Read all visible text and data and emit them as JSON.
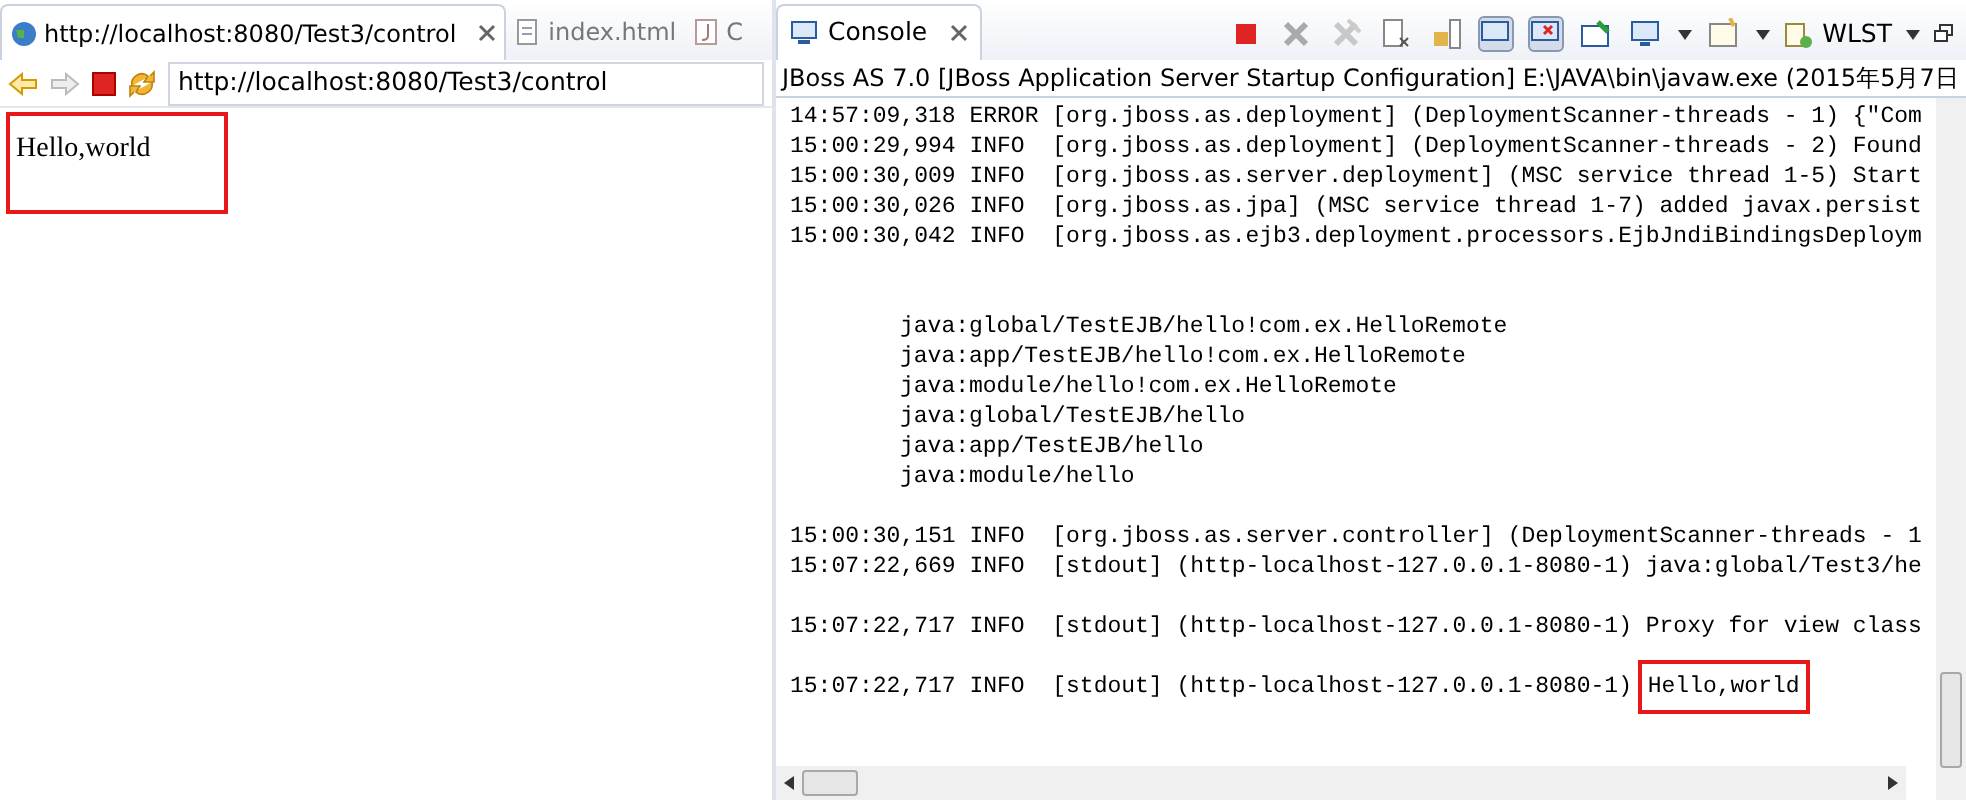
{
  "browser": {
    "tabs": [
      {
        "label": "http://localhost:8080/Test3/control",
        "kind": "web",
        "selected": true
      },
      {
        "label": "index.html",
        "kind": "file",
        "selected": false
      },
      {
        "label": "C",
        "kind": "java",
        "selected": false
      }
    ],
    "address": "http://localhost:8080/Test3/control",
    "page_text": "Hello,world"
  },
  "console": {
    "tab": "Console",
    "toolbar_label": "WLST",
    "description": "JBoss AS 7.0 [JBoss Application Server Startup Configuration] E:\\JAVA\\bin\\javaw.exe (2015年5月7日",
    "lines": [
      {
        "kind": "log",
        "text": "14:57:09,318 ERROR [org.jboss.as.deployment] (DeploymentScanner-threads - 1) {\"Com"
      },
      {
        "kind": "log",
        "text": "15:00:29,994 INFO  [org.jboss.as.deployment] (DeploymentScanner-threads - 2) Found"
      },
      {
        "kind": "log",
        "text": "15:00:30,009 INFO  [org.jboss.as.server.deployment] (MSC service thread 1-5) Start"
      },
      {
        "kind": "log",
        "text": "15:00:30,026 INFO  [org.jboss.as.jpa] (MSC service thread 1-7) added javax.persist"
      },
      {
        "kind": "log",
        "text": "15:00:30,042 INFO  [org.jboss.as.ejb3.deployment.processors.EjbJndiBindingsDeploym"
      },
      {
        "kind": "blank"
      },
      {
        "kind": "blank"
      },
      {
        "kind": "binding",
        "text": "java:global/TestEJB/hello!com.ex.HelloRemote"
      },
      {
        "kind": "binding",
        "text": "java:app/TestEJB/hello!com.ex.HelloRemote"
      },
      {
        "kind": "binding",
        "text": "java:module/hello!com.ex.HelloRemote"
      },
      {
        "kind": "binding",
        "text": "java:global/TestEJB/hello"
      },
      {
        "kind": "binding",
        "text": "java:app/TestEJB/hello"
      },
      {
        "kind": "binding",
        "text": "java:module/hello"
      },
      {
        "kind": "blank"
      },
      {
        "kind": "log",
        "text": "15:00:30,151 INFO  [org.jboss.as.server.controller] (DeploymentScanner-threads - 1"
      },
      {
        "kind": "log",
        "text": "15:07:22,669 INFO  [stdout] (http-localhost-127.0.0.1-8080-1) java:global/Test3/he"
      },
      {
        "kind": "blank"
      },
      {
        "kind": "log",
        "text": "15:07:22,717 INFO  [stdout] (http-localhost-127.0.0.1-8080-1) Proxy for view class"
      },
      {
        "kind": "blank"
      },
      {
        "kind": "log",
        "text": "15:07:22,717 INFO  [stdout] (http-localhost-127.0.0.1-8080-1) ",
        "highlight": "Hello,world"
      }
    ]
  }
}
